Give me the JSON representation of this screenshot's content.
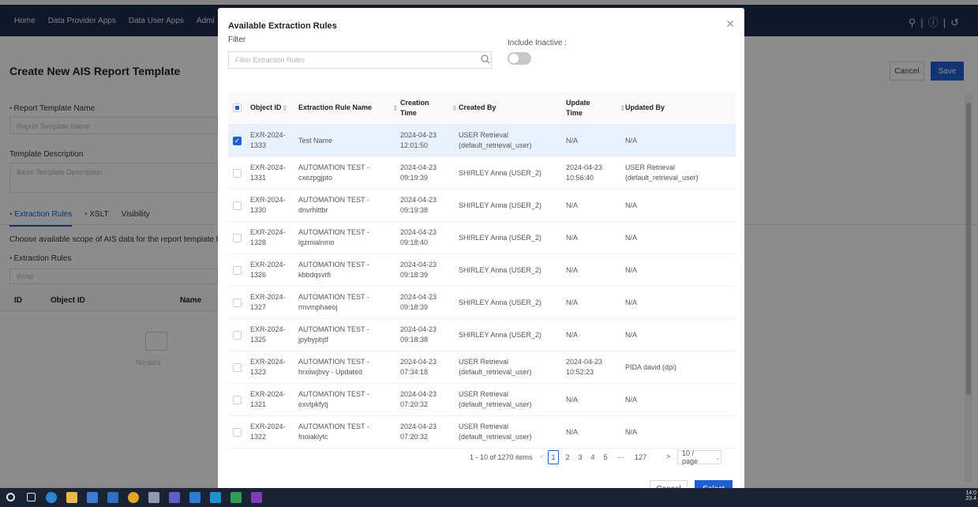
{
  "app": {
    "nav": [
      "Home",
      "Data Provider Apps",
      "Data User Apps",
      "Admi"
    ],
    "top_right_icons": [
      "user-icon",
      "help-icon",
      "logout-icon"
    ]
  },
  "page": {
    "title": "Create New AIS Report Template",
    "cancel_label": "Cancel",
    "save_label": "Save",
    "form": {
      "template_name_label": "Report Template Name",
      "template_name_placeholder": "Report Template Name",
      "description_label": "Template Description",
      "description_placeholder": "Basic Template Description",
      "tabs": [
        "Extraction Rules",
        "XSLT",
        "Visibility"
      ],
      "scope_text": "Choose available scope of AIS data for the report template by se",
      "extraction_rules_label": "Extraction Rules",
      "extraction_rules_placeholder": "Write",
      "columns": [
        "ID",
        "Object ID",
        "Name"
      ],
      "no_data": "No data"
    }
  },
  "modal": {
    "title": "Available Extraction Rules",
    "filter_label": "Filter",
    "filter_placeholder": "Filter Extraction Rules",
    "include_inactive_label": "Include Inactive :",
    "include_inactive": false,
    "columns": {
      "object_id": "Object ID",
      "name": "Extraction Rule Name",
      "created_time": "Creation Time",
      "created_by": "Created By",
      "updated_time": "Update Time",
      "updated_by": "Updated By"
    },
    "rows": [
      {
        "selected": true,
        "oid1": "EXR-2024-",
        "oid2": "1333",
        "name1": "Test Name",
        "name2": "",
        "ct1": "2024-04-23",
        "ct2": "12:01:50",
        "cby1": "USER Retrieval",
        "cby2": "(default_retrieval_user)",
        "ut1": "N/A",
        "ut2": "",
        "uby1": "N/A",
        "uby2": ""
      },
      {
        "selected": false,
        "oid1": "EXR-2024-",
        "oid2": "1331",
        "name1": "AUTOMATION TEST -",
        "name2": "cxezpgjpto",
        "ct1": "2024-04-23",
        "ct2": "09:19:39",
        "cby1": "SHIRLEY Anna (USER_2)",
        "cby2": "",
        "ut1": "2024-04-23",
        "ut2": "10:56:40",
        "uby1": "USER Retrieval",
        "uby2": "(default_retrieval_user)"
      },
      {
        "selected": false,
        "oid1": "EXR-2024-",
        "oid2": "1330",
        "name1": "AUTOMATION TEST -",
        "name2": "dnvrhittbr",
        "ct1": "2024-04-23",
        "ct2": "09:19:38",
        "cby1": "SHIRLEY Anna (USER_2)",
        "cby2": "",
        "ut1": "N/A",
        "ut2": "",
        "uby1": "N/A",
        "uby2": ""
      },
      {
        "selected": false,
        "oid1": "EXR-2024-",
        "oid2": "1328",
        "name1": "AUTOMATION TEST -",
        "name2": "lgzmialnmo",
        "ct1": "2024-04-23",
        "ct2": "09:18:40",
        "cby1": "SHIRLEY Anna (USER_2)",
        "cby2": "",
        "ut1": "N/A",
        "ut2": "",
        "uby1": "N/A",
        "uby2": ""
      },
      {
        "selected": false,
        "oid1": "EXR-2024-",
        "oid2": "1326",
        "name1": "AUTOMATION TEST -",
        "name2": "kbbdqsvrfi",
        "ct1": "2024-04-23",
        "ct2": "09:18:39",
        "cby1": "SHIRLEY Anna (USER_2)",
        "cby2": "",
        "ut1": "N/A",
        "ut2": "",
        "uby1": "N/A",
        "uby2": ""
      },
      {
        "selected": false,
        "oid1": "EXR-2024-",
        "oid2": "1327",
        "name1": "AUTOMATION TEST -",
        "name2": "rmvmphaeoj",
        "ct1": "2024-04-23",
        "ct2": "09:18:39",
        "cby1": "SHIRLEY Anna (USER_2)",
        "cby2": "",
        "ut1": "N/A",
        "ut2": "",
        "uby1": "N/A",
        "uby2": ""
      },
      {
        "selected": false,
        "oid1": "EXR-2024-",
        "oid2": "1325",
        "name1": "AUTOMATION TEST -",
        "name2": "jpybypbjtf",
        "ct1": "2024-04-23",
        "ct2": "09:18:38",
        "cby1": "SHIRLEY Anna (USER_2)",
        "cby2": "",
        "ut1": "N/A",
        "ut2": "",
        "uby1": "N/A",
        "uby2": ""
      },
      {
        "selected": false,
        "oid1": "EXR-2024-",
        "oid2": "1323",
        "name1": "AUTOMATION TEST -",
        "name2": "hrxiiwjbvy - Updated",
        "ct1": "2024-04-23",
        "ct2": "07:34:18",
        "cby1": "USER Retrieval",
        "cby2": "(default_retrieval_user)",
        "ut1": "2024-04-23",
        "ut2": "10:52:23",
        "uby1": "PIDA david (dpi)",
        "uby2": ""
      },
      {
        "selected": false,
        "oid1": "EXR-2024-",
        "oid2": "1321",
        "name1": "AUTOMATION TEST -",
        "name2": "exvtpkfytj",
        "ct1": "2024-04-23",
        "ct2": "07:20:32",
        "cby1": "USER Retrieval",
        "cby2": "(default_retrieval_user)",
        "ut1": "N/A",
        "ut2": "",
        "uby1": "N/A",
        "uby2": ""
      },
      {
        "selected": false,
        "oid1": "EXR-2024-",
        "oid2": "1322",
        "name1": "AUTOMATION TEST -",
        "name2": "fnoiaklytc",
        "ct1": "2024-04-23",
        "ct2": "07:20:32",
        "cby1": "USER Retrieval",
        "cby2": "(default_retrieval_user)",
        "ut1": "N/A",
        "ut2": "",
        "uby1": "N/A",
        "uby2": ""
      }
    ],
    "pagination": {
      "total_text": "1 - 10 of 1270 items",
      "pages": [
        "1",
        "2",
        "3",
        "4",
        "5",
        "···",
        "127"
      ],
      "current": "1",
      "page_size": "10 / page"
    },
    "cancel_label": "Cancel",
    "select_label": "Select"
  },
  "taskbar": {
    "time": "14:0",
    "date": "23.4"
  },
  "colors": {
    "primary": "#1f5fd1",
    "header_bg": "#1c2a4a",
    "selected_row": "#e8f1fd",
    "required": "#e34d59"
  }
}
